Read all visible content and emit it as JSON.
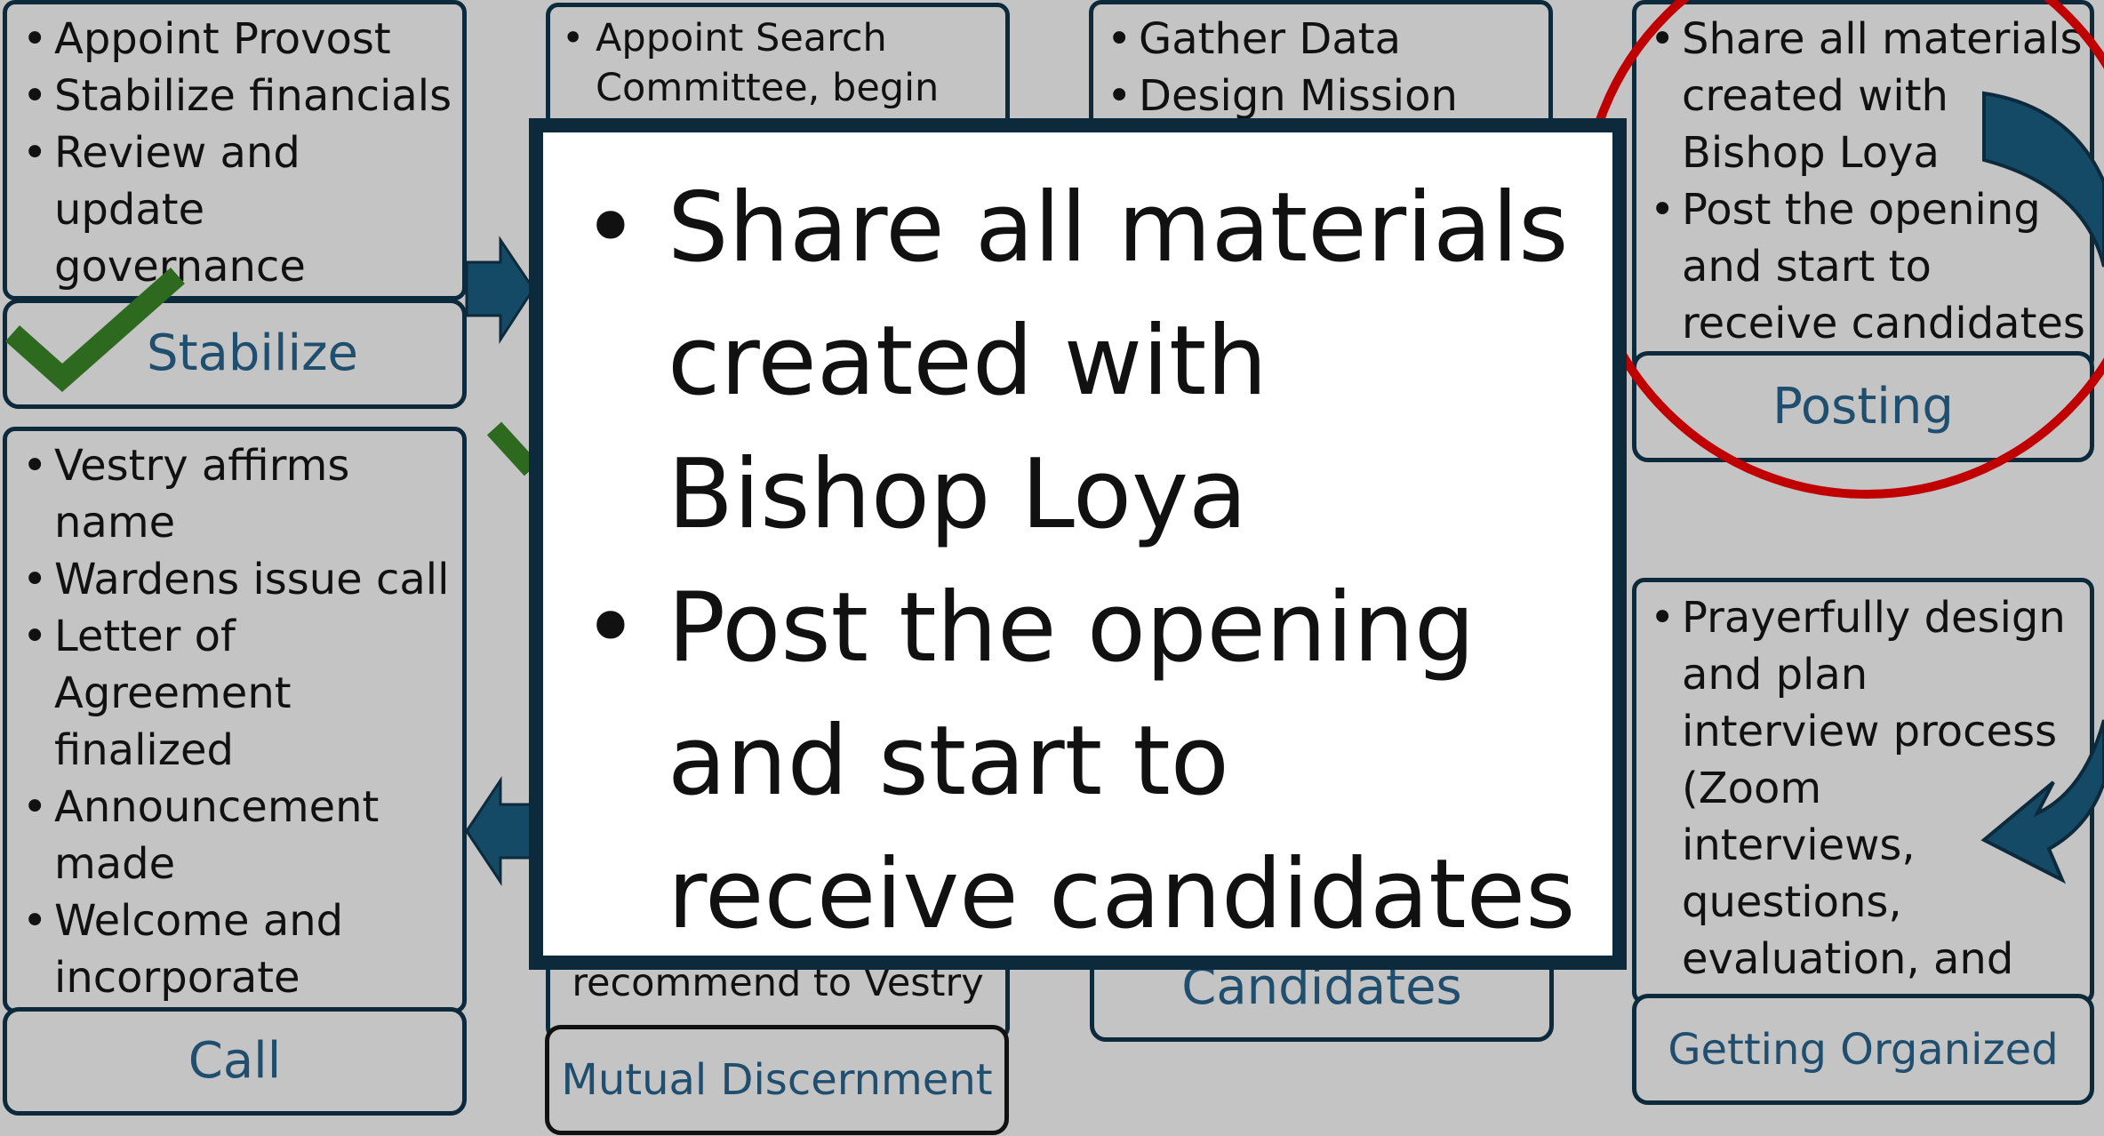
{
  "stages": {
    "stabilize": {
      "label": "Stabilize",
      "bullets": [
        "Appoint Provost",
        "Stabilize financials",
        "Review and update governance documents"
      ]
    },
    "search": {
      "bullets": [
        "Appoint Search Committee, begin"
      ]
    },
    "mission": {
      "bullets": [
        "Gather Data",
        "Design Mission"
      ]
    },
    "posting": {
      "label": "Posting",
      "bullets": [
        "Share all materials created with Bishop Loya",
        "Post the opening and start to receive candidates"
      ]
    },
    "call": {
      "label": "Call",
      "bullets": [
        "Vestry affirms name",
        "Wardens issue call",
        "Letter of Agreement finalized",
        "Announcement made",
        "Welcome and incorporate"
      ]
    },
    "mutual": {
      "label": "Mutual Discernment",
      "fragment": "recommend to Vestry"
    },
    "candidates": {
      "label": "Candidates"
    },
    "organized": {
      "label": "Getting Organized",
      "bullets": [
        "Prayerfully design and plan interview process (Zoom interviews, questions, evaluation, and decisionmaking)"
      ]
    }
  },
  "zoom": {
    "bullets": [
      "Share all materials created with Bishop Loya",
      "Post the opening and start to receive candidates"
    ]
  },
  "colors": {
    "background": "#c4c4c4",
    "border": "#0c2a3c",
    "label_text": "#1f4e6e",
    "arrow": "#154a66",
    "check": "#2d6a1f",
    "highlight_circle": "#c00000"
  },
  "icons": [
    "checkmark-icon",
    "highlight-circle",
    "arrow-right",
    "arrow-left",
    "curved-arrow"
  ]
}
